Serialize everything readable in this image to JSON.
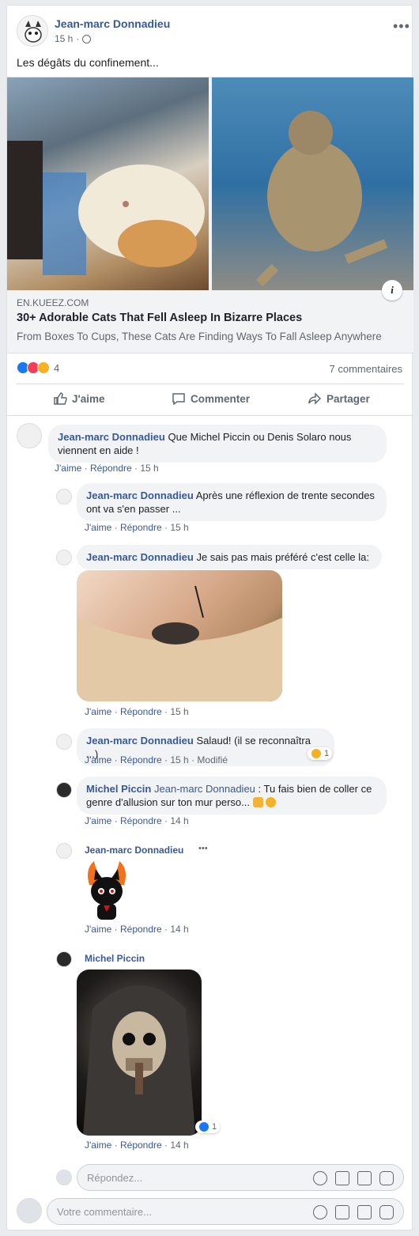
{
  "post": {
    "author": "Jean-marc Donnadieu",
    "time": "15 h",
    "privacy_icon": "globe-icon",
    "more_icon": "more-options-icon",
    "text": "Les dégâts du confinement...",
    "link": {
      "domain": "EN.KUEEZ.COM",
      "title": "30+ Adorable Cats That Fell Asleep In Bizarre Places",
      "description": "From Boxes To Cups, These Cats Are Finding Ways To Fall Asleep Anywhere"
    },
    "reactions_count": "4",
    "comments_count": "7 commentaires",
    "actions": {
      "like": "J'aime",
      "comment": "Commenter",
      "share": "Partager"
    }
  },
  "comments": [
    {
      "author": "Jean-marc Donnadieu",
      "text": "Que Michel Piccin ou Denis Solaro nous viennent en aide !",
      "like": "J'aime",
      "reply": "Répondre",
      "time": "15 h"
    },
    {
      "author": "Jean-marc Donnadieu",
      "text": "Après une réflexion de trente secondes ont va s'en passer ...",
      "like": "J'aime",
      "reply": "Répondre",
      "time": "15 h"
    },
    {
      "author": "Jean-marc Donnadieu",
      "text": "Je sais pas mais préféré c'est celle la:",
      "like": "J'aime",
      "reply": "Répondre",
      "time": "15 h"
    },
    {
      "author": "Jean-marc Donnadieu",
      "text": "Salaud! (il se reconnaîtra ...)",
      "like": "J'aime",
      "reply": "Répondre",
      "time": "15 h",
      "edited": "Modifié",
      "reaction_count": "1"
    },
    {
      "author": "Michel Piccin",
      "mention": "Jean-marc Donnadieu",
      "text": ": Tu fais bien de coller ce genre d'allusion sur ton mur perso...",
      "like": "J'aime",
      "reply": "Répondre",
      "time": "14 h"
    },
    {
      "author": "Jean-marc Donnadieu",
      "like": "J'aime",
      "reply": "Répondre",
      "time": "14 h"
    },
    {
      "author": "Michel Piccin",
      "like": "J'aime",
      "reply": "Répondre",
      "time": "14 h",
      "reaction_count": "1"
    }
  ],
  "reply_input": {
    "placeholder": "Répondez..."
  },
  "comment_input": {
    "placeholder": "Votre commentaire..."
  },
  "colors": {
    "link": "#385898",
    "like_blue": "#1877f2",
    "love_red": "#f33e58",
    "haha_yellow": "#f7b125"
  }
}
